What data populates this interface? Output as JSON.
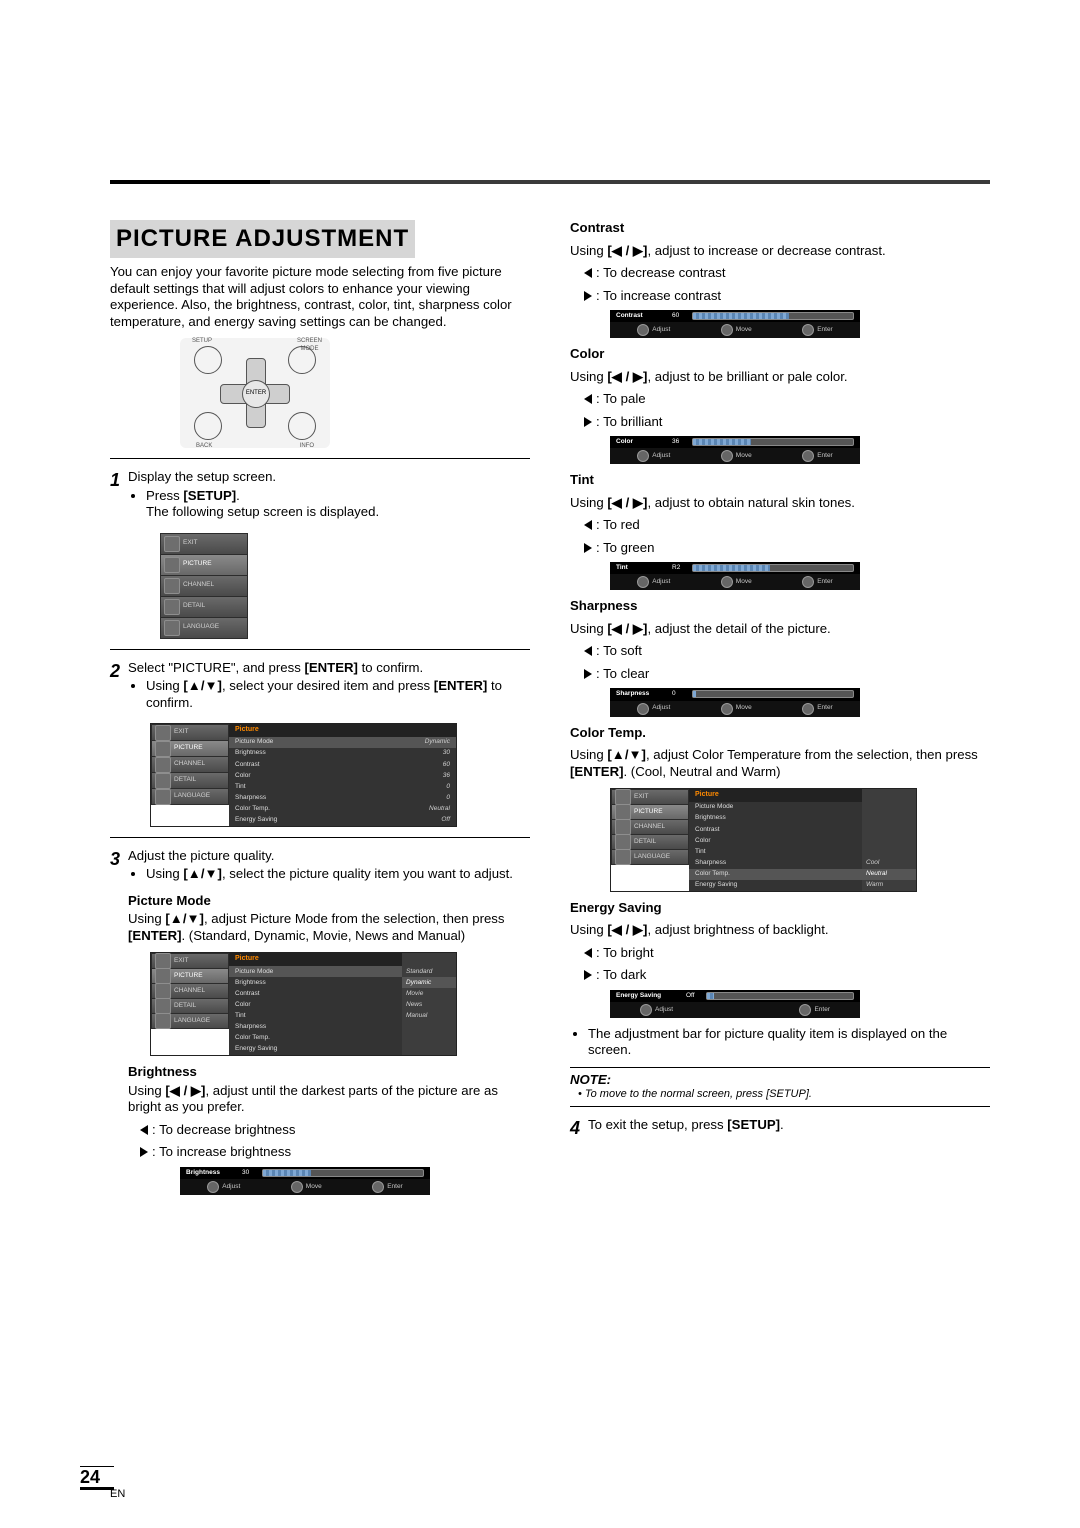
{
  "page_number": "24",
  "lang_tag": "EN",
  "title": "PICTURE ADJUSTMENT",
  "intro": "You can enjoy your favorite picture mode selecting from five picture default settings that will adjust colors to enhance your viewing experience. Also, the brightness, contrast, color, tint, sharpness color temperature, and energy saving settings can be changed.",
  "remote": {
    "setup": "SETUP",
    "screen": "SCREEN\nMODE",
    "back": "BACK",
    "info": "INFO",
    "enter": "ENTER"
  },
  "step1": {
    "text": "Display the setup screen.",
    "bul1a": "Press ",
    "bul1b": "[SETUP]",
    "bul1c": ".",
    "sub": "The following setup screen is displayed."
  },
  "menu": [
    "EXIT",
    "PICTURE",
    "CHANNEL",
    "DETAIL",
    "LANGUAGE"
  ],
  "step2": {
    "text1": "Select \"PICTURE\", and press ",
    "text2": "[ENTER]",
    "text3": " to confirm.",
    "bul1a": "Using ",
    "bul1b": "[▲/▼]",
    "bul1c": ", select your desired item and press ",
    "bul1d": "[ENTER]",
    "bul1e": " to confirm."
  },
  "table1": {
    "header": "Picture",
    "rows": [
      {
        "k": "Picture Mode",
        "v": "Dynamic"
      },
      {
        "k": "Brightness",
        "v": "30"
      },
      {
        "k": "Contrast",
        "v": "60"
      },
      {
        "k": "Color",
        "v": "36"
      },
      {
        "k": "Tint",
        "v": "0"
      },
      {
        "k": "Sharpness",
        "v": "0"
      },
      {
        "k": "Color Temp.",
        "v": "Neutral"
      },
      {
        "k": "Energy Saving",
        "v": "Off"
      }
    ]
  },
  "step3": {
    "text": "Adjust the picture quality.",
    "bul1a": "Using ",
    "bul1b": "[▲/▼]",
    "bul1c": ", select the picture quality item you want to adjust."
  },
  "picmode": {
    "head": "Picture Mode",
    "t1": "Using ",
    "t2": "[▲/▼]",
    "t3": ", adjust Picture Mode from the selection, then press ",
    "t4": "[ENTER]",
    "t5": ". (Standard, Dynamic, Movie, News and Manual)",
    "options": [
      "Standard",
      "Dynamic",
      "Movie",
      "News",
      "Manual"
    ]
  },
  "table2": {
    "header": "Picture",
    "rows": [
      "Picture Mode",
      "Brightness",
      "Contrast",
      "Color",
      "Tint",
      "Sharpness",
      "Color Temp.",
      "Energy Saving"
    ]
  },
  "brightness": {
    "head": "Brightness",
    "t1": "Using ",
    "t2": "[◀ / ▶]",
    "t3": ", adjust until the darkest parts of the picture are as bright as you prefer.",
    "l": ": To decrease brightness",
    "r": ": To increase brightness",
    "slider": {
      "name": "Brightness",
      "val": "30",
      "fill": 30
    }
  },
  "contrast": {
    "head": "Contrast",
    "t1": "Using ",
    "t2": "[◀ / ▶]",
    "t3": ", adjust to increase or decrease contrast.",
    "l": ": To decrease contrast",
    "r": ": To increase contrast",
    "slider": {
      "name": "Contrast",
      "val": "60",
      "fill": 60
    }
  },
  "color": {
    "head": "Color",
    "t1": "Using ",
    "t2": "[◀ / ▶]",
    "t3": ", adjust to be brilliant or pale color.",
    "l": ": To pale",
    "r": ": To brilliant",
    "slider": {
      "name": "Color",
      "val": "36",
      "fill": 36
    }
  },
  "tint": {
    "head": "Tint",
    "t1": "Using ",
    "t2": "[◀ / ▶]",
    "t3": ", adjust to obtain natural skin tones.",
    "l": ": To red",
    "r": ": To green",
    "slider": {
      "name": "Tint",
      "val": "R2",
      "fill": 48
    }
  },
  "sharp": {
    "head": "Sharpness",
    "t1": "Using ",
    "t2": "[◀ / ▶]",
    "t3": ", adjust the detail of the picture.",
    "l": ": To soft",
    "r": ": To clear",
    "slider": {
      "name": "Sharpness",
      "val": "0",
      "fill": 0
    }
  },
  "ctemp": {
    "head": "Color Temp.",
    "t1": "Using ",
    "t2": "[▲/▼]",
    "t3": ", adjust Color Temperature from the selection, then press ",
    "t4": "[ENTER]",
    "t5": ". (Cool, Neutral and Warm)",
    "options": [
      "Cool",
      "Neutral",
      "Warm"
    ]
  },
  "energy": {
    "head": "Energy Saving",
    "t1": "Using ",
    "t2": "[◀ / ▶]",
    "t3": ", adjust brightness of backlight.",
    "l": ": To bright",
    "r": ": To dark",
    "slider": {
      "name": "Energy Saving",
      "val": "Off"
    }
  },
  "afterenergy": "The adjustment bar for picture quality item is displayed on the screen.",
  "note": {
    "title": "NOTE:",
    "body": "To move to the normal screen, press [SETUP]."
  },
  "step4": {
    "t1": "To exit the setup, press ",
    "t2": "[SETUP]",
    "t3": "."
  },
  "hints": {
    "adjust": "Adjust",
    "move": "Move",
    "enter": "Enter"
  }
}
